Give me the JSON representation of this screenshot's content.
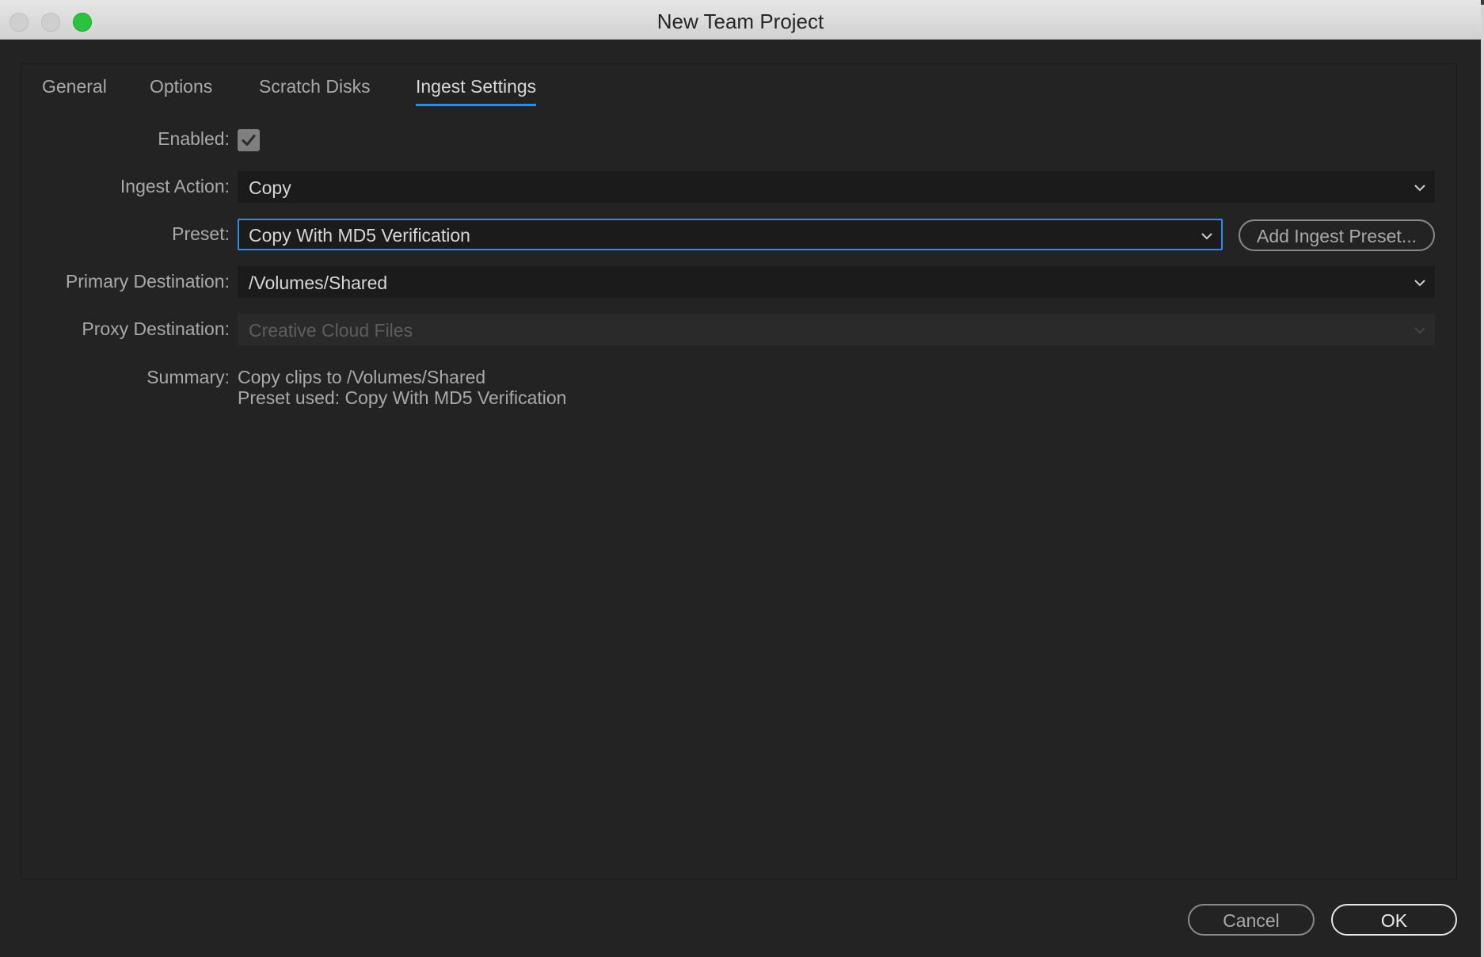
{
  "window": {
    "title": "New Team Project"
  },
  "tabs": [
    {
      "label": "General"
    },
    {
      "label": "Options"
    },
    {
      "label": "Scratch Disks"
    },
    {
      "label": "Ingest Settings",
      "active": true
    }
  ],
  "form": {
    "enabled_label": "Enabled:",
    "enabled_checked": true,
    "ingest_action_label": "Ingest Action:",
    "ingest_action_value": "Copy",
    "preset_label": "Preset:",
    "preset_value": "Copy With MD5 Verification",
    "add_preset_label": "Add Ingest Preset...",
    "primary_destination_label": "Primary Destination:",
    "primary_destination_value": "/Volumes/Shared",
    "proxy_destination_label": "Proxy Destination:",
    "proxy_destination_value": "Creative Cloud Files",
    "summary_label": "Summary:",
    "summary_line1": "Copy clips to /Volumes/Shared",
    "summary_line2": "Preset used: Copy With MD5 Verification"
  },
  "footer": {
    "cancel_label": "Cancel",
    "ok_label": "OK"
  },
  "colors": {
    "accent": "#2d8ceb",
    "background": "#232323",
    "field": "#1b1b1b",
    "maximize": "#29c33f"
  }
}
